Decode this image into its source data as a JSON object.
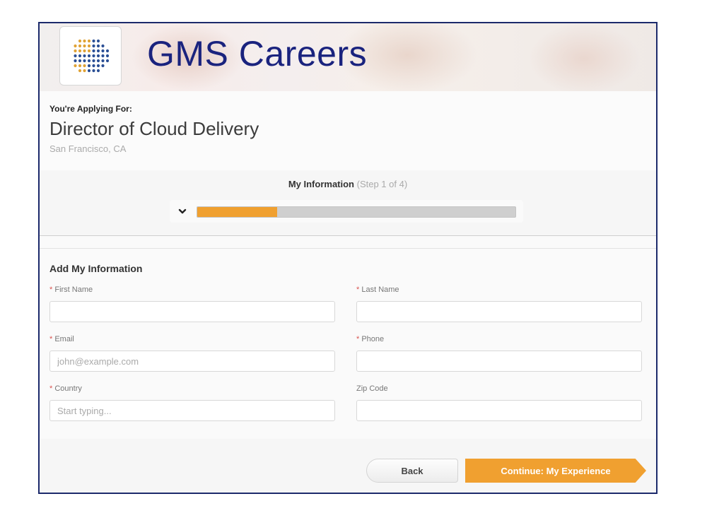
{
  "header": {
    "brand": "GMS Careers"
  },
  "job": {
    "applying_label": "You're Applying For:",
    "title": "Director of Cloud Delivery",
    "location": "San Francisco, CA"
  },
  "progress": {
    "step_name": "My Information",
    "step_counter": "(Step 1 of 4)",
    "fraction": 0.25,
    "toggle_icon": "chevron-down-icon"
  },
  "form": {
    "title": "Add My Information",
    "first_name": {
      "label": "First Name",
      "required": "*",
      "value": "",
      "placeholder": ""
    },
    "last_name": {
      "label": "Last Name",
      "required": "*",
      "value": "",
      "placeholder": ""
    },
    "email": {
      "label": "Email",
      "required": "*",
      "value": "",
      "placeholder": "john@example.com"
    },
    "phone": {
      "label": "Phone",
      "required": "*",
      "value": "",
      "placeholder": ""
    },
    "country": {
      "label": "Country",
      "required": "*",
      "value": "",
      "placeholder": "Start typing..."
    },
    "zip": {
      "label": "Zip Code",
      "value": "",
      "placeholder": ""
    }
  },
  "actions": {
    "back_label": "Back",
    "continue_label": "Continue: My Experience"
  },
  "colors": {
    "brand": "#1a237e",
    "accent": "#f0a030",
    "required": "#d9534f"
  }
}
